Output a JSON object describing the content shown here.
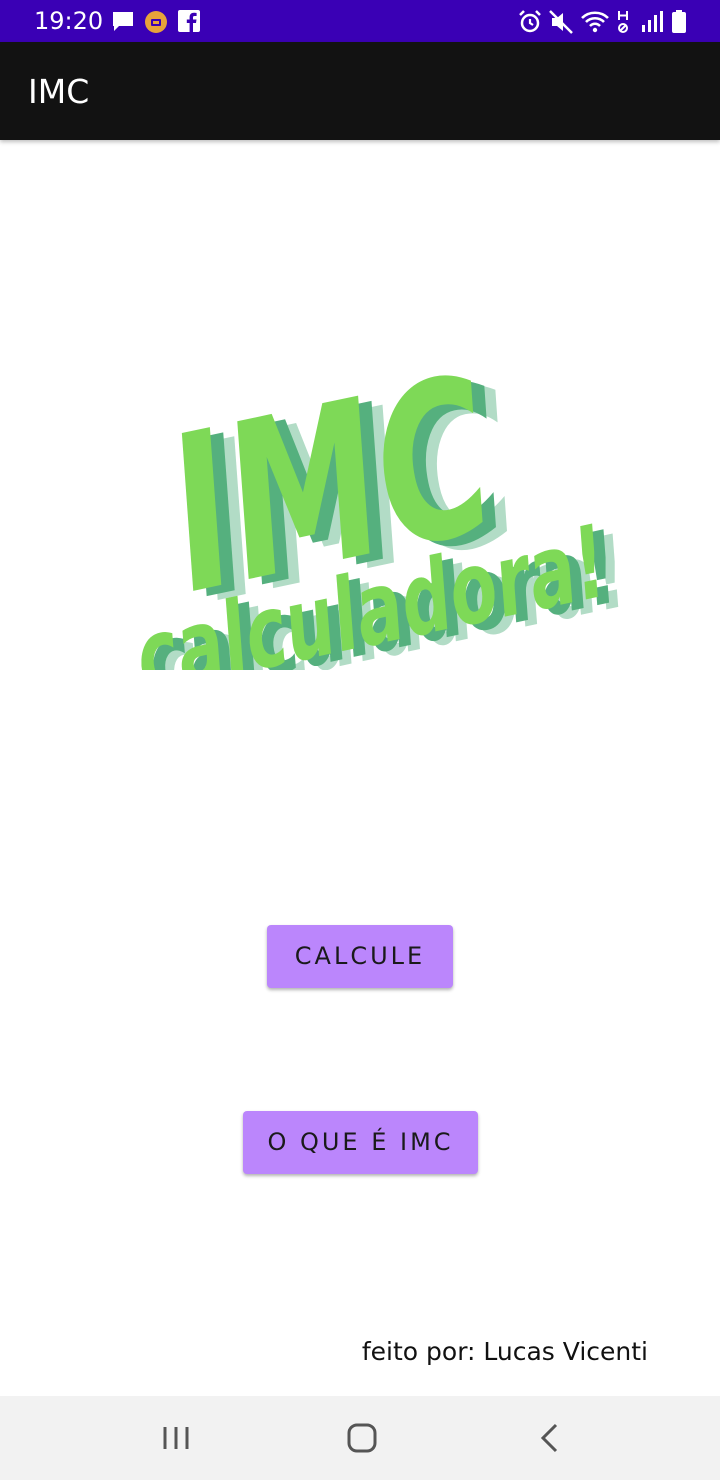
{
  "status_bar": {
    "time": "19:20",
    "left_icons": [
      "chat-bubble-icon",
      "vpn-badge-icon",
      "facebook-icon"
    ],
    "right_icons": [
      "alarm-icon",
      "mute-icon",
      "wifi-icon",
      "data-h-icon",
      "signal-icon",
      "battery-icon"
    ],
    "background": "#3a00b5"
  },
  "app_bar": {
    "title": "IMC",
    "background": "#121212"
  },
  "logo": {
    "line1": "IMC",
    "line2": "calculadora!",
    "colors": {
      "front": "#7ed957",
      "shadow": "#55b07e",
      "shadow_light": "#b2dcc6"
    }
  },
  "buttons": {
    "calcule": "CALCULE",
    "o_que_e_imc": "O QUE É IMC",
    "color": "#bb86fc"
  },
  "credit": "feito por: Lucas Vicenti",
  "nav_bar": {
    "icons": [
      "recents-icon",
      "home-icon",
      "back-icon"
    ]
  }
}
